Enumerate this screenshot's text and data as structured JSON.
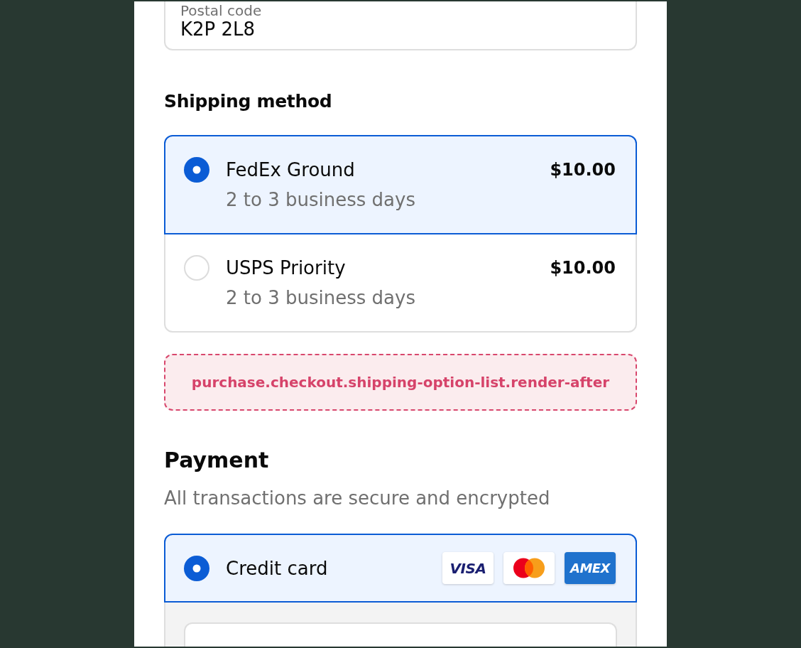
{
  "postal_code": {
    "label": "Postal code",
    "value": "K2P 2L8"
  },
  "shipping": {
    "title": "Shipping method",
    "options": [
      {
        "name": "FedEx Ground",
        "detail": "2 to 3 business days",
        "price": "$10.00",
        "selected": true
      },
      {
        "name": "USPS Priority",
        "detail": "2 to 3 business days",
        "price": "$10.00",
        "selected": false
      }
    ]
  },
  "extension_slot": {
    "text": "purchase.checkout.shipping-option-list.render-after"
  },
  "payment": {
    "title": "Payment",
    "subtitle": "All transactions are secure and encrypted",
    "methods": [
      {
        "name": "Credit card",
        "selected": true,
        "card_brands": [
          {
            "kind": "visa",
            "label": "VISA"
          },
          {
            "kind": "mastercard"
          },
          {
            "kind": "amex",
            "label": "AMEX"
          }
        ]
      }
    ]
  }
}
